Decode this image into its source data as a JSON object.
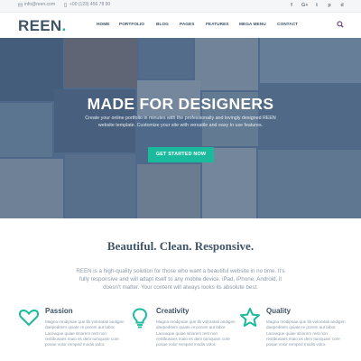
{
  "topbar": {
    "email": "info@reen.com",
    "phone": "+00 (123) 456 78 90",
    "socials": [
      "f",
      "G+",
      "t",
      "p",
      "d"
    ]
  },
  "nav": {
    "logo_text": "REEN",
    "logo_dot": ".",
    "menu": [
      "HOME",
      "PORTFOLIO",
      "BLOG",
      "PAGES",
      "FEATURES",
      "MEGA MENU",
      "CONTACT"
    ]
  },
  "hero": {
    "title": "MADE FOR DESIGNERS",
    "text": "Create your online portfolio in minutes with the professionally and lovingly designed REEN website template. Customize your site with versatile and easy to use features.",
    "button": "GET STARTED NOW"
  },
  "intro": {
    "title": "Beautiful. Clean. Responsive.",
    "text": "REEN is a high-quality solution for those who want a beautiful website in no time. It's fully responsive and will adapt itself to any mobile device. iPad, iPhone, Android, it doesn't matter. Your content will always looks its absolute best."
  },
  "features": [
    {
      "icon": "heart-icon",
      "title": "Passion",
      "text": "Magna modipsae que lib voloratati andigen daepeditem quiate re porem aut labor. Laceaque quiae sitiorem rest non restibusaes maio es dem tumquam core posae volor remped modis volor."
    },
    {
      "icon": "lightbulb-icon",
      "title": "Creativity",
      "text": "Magna modipsae que lib voloratati andigen daepeditem quiate re porem aut labor. Laceaque quiae sitiorem rest non restibusaes maio es dem tumquam core posae volor remped modis volor."
    },
    {
      "icon": "star-icon",
      "title": "Quality",
      "text": "Magna modipsae que lib voloratati andigen daepeditem quiate re porem aut labor. Laceaque quiae sitiorem rest non restibusaes maio es dem tumquam core posae volor remped modis volor."
    }
  ],
  "colors": {
    "accent": "#1abb9c",
    "heading": "#3f5467",
    "hero_overlay": "#4e6a8a"
  }
}
